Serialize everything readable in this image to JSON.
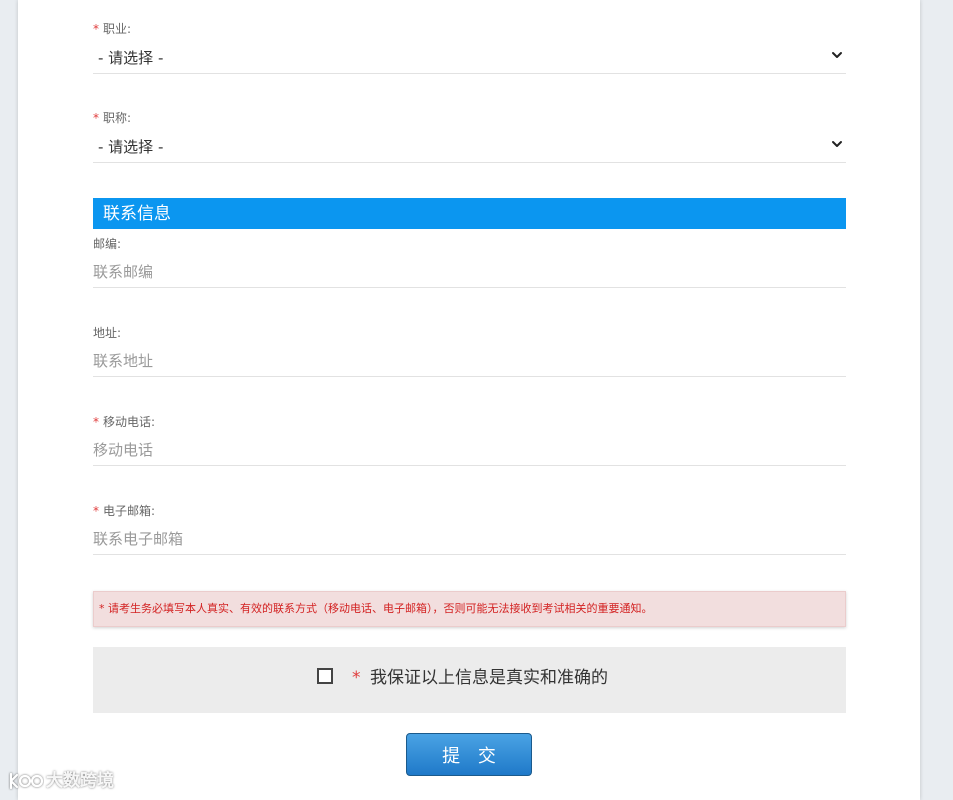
{
  "form": {
    "occupation": {
      "required_mark": "*",
      "label": "职业:",
      "selected": "- 请选择 -"
    },
    "title": {
      "required_mark": "*",
      "label": "职称:",
      "selected": "- 请选择 -"
    },
    "contact_section": {
      "title": "联系信息",
      "color": "#0b96f0"
    },
    "postcode": {
      "label": "邮编:",
      "placeholder": "联系邮编"
    },
    "address": {
      "label": "地址:",
      "placeholder": "联系地址"
    },
    "mobile": {
      "required_mark": "*",
      "label": "移动电话:",
      "placeholder": "移动电话"
    },
    "email": {
      "required_mark": "*",
      "label": "电子邮箱:",
      "placeholder": "联系电子邮箱"
    },
    "notice": "* 请考生务必填写本人真实、有效的联系方式（移动电话、电子邮箱），否则可能无法接收到考试相关的重要通知。",
    "agreement": {
      "required_mark": "*",
      "text": "我保证以上信息是真实和准确的",
      "checked": false
    },
    "submit_label": "提 交"
  },
  "watermark": {
    "text": "大数跨境",
    "icon": "logo-icon"
  },
  "colors": {
    "accent": "#0b96f0",
    "required": "#e03c3c",
    "notice_text": "#d32222",
    "notice_bg": "#f2dede"
  }
}
